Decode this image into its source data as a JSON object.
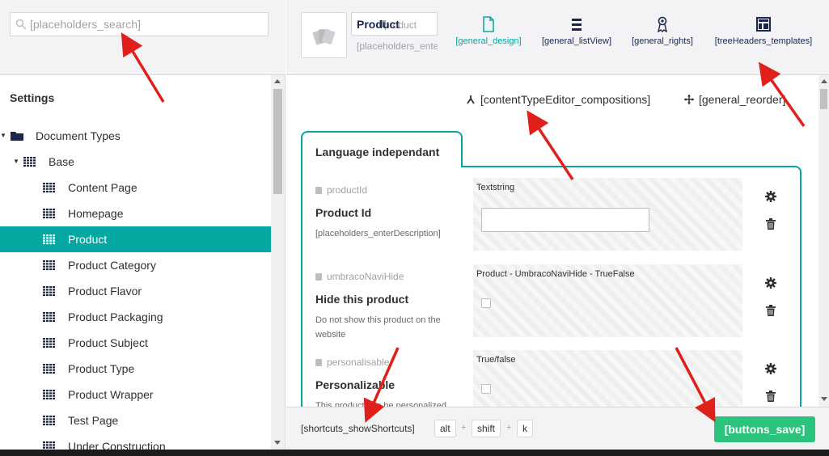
{
  "search": {
    "placeholder": "[placeholders_search]",
    "icon": "search-icon"
  },
  "sidebar": {
    "section_title": "Settings",
    "tree": [
      {
        "label": "Document Types",
        "level": 0,
        "icon": "folder-icon",
        "expanded": true,
        "active": false
      },
      {
        "label": "Base",
        "level": 1,
        "icon": "doctype-icon",
        "expanded": true,
        "active": false
      },
      {
        "label": "Content Page",
        "level": 2,
        "icon": "doctype-icon",
        "active": false
      },
      {
        "label": "Homepage",
        "level": 2,
        "icon": "doctype-icon",
        "active": false
      },
      {
        "label": "Product",
        "level": 2,
        "icon": "doctype-icon",
        "active": true
      },
      {
        "label": "Product Category",
        "level": 2,
        "icon": "doctype-icon",
        "active": false
      },
      {
        "label": "Product Flavor",
        "level": 2,
        "icon": "doctype-icon",
        "active": false
      },
      {
        "label": "Product Packaging",
        "level": 2,
        "icon": "doctype-icon",
        "active": false
      },
      {
        "label": "Product Subject",
        "level": 2,
        "icon": "doctype-icon",
        "active": false
      },
      {
        "label": "Product Type",
        "level": 2,
        "icon": "doctype-icon",
        "active": false
      },
      {
        "label": "Product Wrapper",
        "level": 2,
        "icon": "doctype-icon",
        "active": false
      },
      {
        "label": "Test Page",
        "level": 2,
        "icon": "doctype-icon",
        "active": false
      },
      {
        "label": "Under Construction",
        "level": 2,
        "icon": "doctype-icon",
        "active": false
      }
    ]
  },
  "header": {
    "icon": "cards-icon",
    "name_value": "Product",
    "alias_value": "product",
    "description_placeholder": "[placeholders_enterDescription]",
    "tabs": [
      {
        "label": "[general_design]",
        "icon": "document-icon",
        "active": true
      },
      {
        "label": "[general_listView]",
        "icon": "list-icon",
        "active": false
      },
      {
        "label": "[general_rights]",
        "icon": "rights-icon",
        "active": false
      },
      {
        "label": "[treeHeaders_templates]",
        "icon": "layout-icon",
        "active": false
      }
    ]
  },
  "toolbar": {
    "compositions_label": "[contentTypeEditor_compositions]",
    "reorder_label": "[general_reorder]"
  },
  "group": {
    "tab_label": "Language independant",
    "properties": [
      {
        "alias": "productId",
        "name": "Product Id",
        "description": "[placeholders_enterDescription]",
        "editor": "Textstring",
        "preview": "text"
      },
      {
        "alias": "umbracoNaviHide",
        "name": "Hide this product",
        "description": "Do not show this product on the website",
        "editor": "Product - UmbracoNaviHide - TrueFalse",
        "preview": "checkbox"
      },
      {
        "alias": "personalisable",
        "name": "Personalizable",
        "description": "This product can be personalized",
        "editor": "True/false",
        "preview": "checkbox"
      }
    ]
  },
  "footer": {
    "shortcuts_label": "[shortcuts_showShortcuts]",
    "keys": [
      "alt",
      "shift",
      "k"
    ],
    "key_separator": "+",
    "save_label": "[buttons_save]"
  },
  "colors": {
    "accent": "#04a8a0",
    "save": "#2bc37c",
    "annotation": "#e0201b"
  }
}
